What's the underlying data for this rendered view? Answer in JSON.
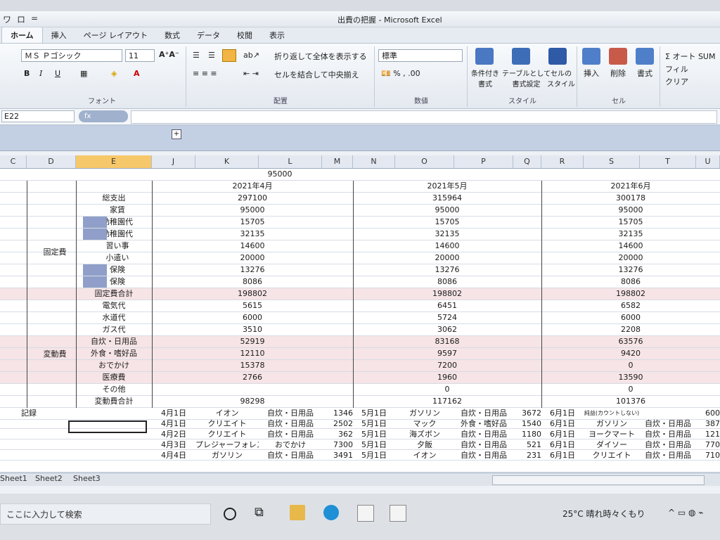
{
  "window": {
    "title": "出費の把握 - Microsoft Excel",
    "qat": [
      "ワ",
      "ロ",
      "="
    ]
  },
  "ribbon_tabs": [
    "ホーム",
    "挿入",
    "ページ レイアウト",
    "数式",
    "データ",
    "校閲",
    "表示"
  ],
  "ribbon": {
    "font_name": "ＭＳ Ｐゴシック",
    "font_size": "11",
    "font_group_label": "フォント",
    "alignment_group_label": "配置",
    "wrap_text": "折り返して全体を表示する",
    "merge_center": "セルを結合して中央揃え",
    "number_format": "標準",
    "number_group_label": "数値",
    "cond_format": "条件付き\n書式",
    "table_format": "テーブルとして\n書式設定",
    "cell_style": "セルの\nスタイル",
    "style_group_label": "スタイル",
    "insert": "挿入",
    "delete": "削除",
    "format": "書式",
    "cell_group_label": "セル",
    "autosum": "Σ オート SUM",
    "fill": "フィル",
    "clear": "クリア"
  },
  "formula_bar": {
    "name_box": "E22",
    "fx_label": "fx"
  },
  "columns": [
    {
      "id": "C",
      "w": 38
    },
    {
      "id": "D",
      "w": 70
    },
    {
      "id": "E",
      "w": 108,
      "selected": true
    },
    {
      "id": "J",
      "w": 62
    },
    {
      "id": "K",
      "w": 90
    },
    {
      "id": "L",
      "w": 90
    },
    {
      "id": "M",
      "w": 44
    },
    {
      "id": "N",
      "w": 60
    },
    {
      "id": "O",
      "w": 84
    },
    {
      "id": "P",
      "w": 84
    },
    {
      "id": "Q",
      "w": 40
    },
    {
      "id": "R",
      "w": 60
    },
    {
      "id": "S",
      "w": 80
    },
    {
      "id": "T",
      "w": 80
    },
    {
      "id": "U",
      "w": 34
    }
  ],
  "top_value": "95000",
  "months": [
    "2021年4月",
    "2021年5月",
    "2021年6月"
  ],
  "total": {
    "label": "総支出",
    "values": [
      "297100",
      "315964",
      "300178"
    ]
  },
  "fixed": {
    "label": "固定費",
    "rows": [
      {
        "label": "家賃",
        "values": [
          "95000",
          "95000",
          "95000"
        ]
      },
      {
        "label": "幼稚園代",
        "values": [
          "15705",
          "15705",
          "15705"
        ],
        "redacted": true
      },
      {
        "label": "幼稚園代",
        "values": [
          "32135",
          "32135",
          "32135"
        ],
        "redacted": true
      },
      {
        "label": "習い事",
        "values": [
          "14600",
          "14600",
          "14600"
        ]
      },
      {
        "label": "小遣い",
        "values": [
          "20000",
          "20000",
          "20000"
        ]
      },
      {
        "label": "保険",
        "values": [
          "13276",
          "13276",
          "13276"
        ],
        "redacted": true
      },
      {
        "label": "保険",
        "values": [
          "8086",
          "8086",
          "8086"
        ],
        "redacted": true
      }
    ],
    "subtotal": {
      "label": "固定費合計",
      "values": [
        "198802",
        "198802",
        "198802"
      ]
    }
  },
  "variable": {
    "label": "変動費",
    "rows": [
      {
        "label": "電気代",
        "values": [
          "5615",
          "6451",
          "6582"
        ]
      },
      {
        "label": "水道代",
        "values": [
          "6000",
          "5724",
          "6000"
        ]
      },
      {
        "label": "ガス代",
        "values": [
          "3510",
          "3062",
          "2208"
        ]
      },
      {
        "label": "自炊・日用品",
        "values": [
          "52919",
          "83168",
          "63576"
        ]
      },
      {
        "label": "外食・嗜好品",
        "values": [
          "12110",
          "9597",
          "9420"
        ]
      },
      {
        "label": "おでかけ",
        "values": [
          "15378",
          "7200",
          "0"
        ]
      },
      {
        "label": "医療費",
        "values": [
          "2766",
          "1960",
          "13590"
        ]
      },
      {
        "label": "その他",
        "values": [
          "",
          "0",
          "0"
        ]
      }
    ],
    "subtotal": {
      "label": "変動費合計",
      "values": [
        "98298",
        "117162",
        "101376"
      ]
    }
  },
  "record_label": "記録",
  "records": [
    [
      [
        "4月1日",
        "イオン",
        "自炊・日用品",
        "1346"
      ],
      [
        "5月1日",
        "ガソリン",
        "自炊・日用品",
        "3672"
      ],
      [
        "6月1日",
        "純益(カウントしない)",
        "",
        "600"
      ]
    ],
    [
      [
        "4月1日",
        "クリエイト",
        "自炊・日用品",
        "2502"
      ],
      [
        "5月1日",
        "マック",
        "外食・嗜好品",
        "1540"
      ],
      [
        "6月1日",
        "ガソリン",
        "自炊・日用品",
        "387"
      ]
    ],
    [
      [
        "4月2日",
        "クリエイト",
        "自炊・日用品",
        "362"
      ],
      [
        "5月1日",
        "海ズボン",
        "自炊・日用品",
        "1180"
      ],
      [
        "6月1日",
        "ヨークマート",
        "自炊・日用品",
        "121"
      ]
    ],
    [
      [
        "4月3日",
        "プレジャーフォレスト",
        "おでかけ",
        "7300"
      ],
      [
        "5月1日",
        "夕飯",
        "自炊・日用品",
        "521"
      ],
      [
        "6月1日",
        "ダイソー",
        "自炊・日用品",
        "770"
      ]
    ],
    [
      [
        "4月4日",
        "ガソリン",
        "自炊・日用品",
        "3491"
      ],
      [
        "5月1日",
        "イオン",
        "自炊・日用品",
        "231"
      ],
      [
        "6月1日",
        "クリエイト",
        "自炊・日用品",
        "710"
      ]
    ]
  ],
  "sheet_tabs": [
    "Sheet1",
    "Sheet2",
    "Sheet3"
  ],
  "taskbar": {
    "search_placeholder": "ここに入力して検索",
    "weather": "25°C 晴れ時々くもり"
  }
}
